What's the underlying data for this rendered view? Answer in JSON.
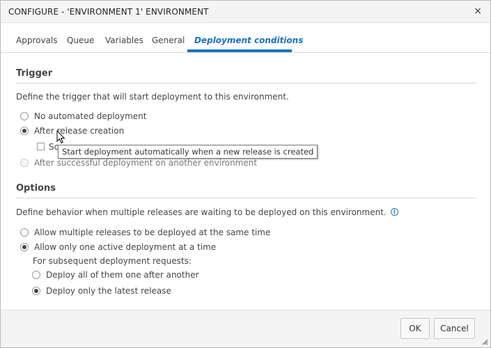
{
  "dialog": {
    "title": "CONFIGURE - 'ENVIRONMENT 1' ENVIRONMENT",
    "close_glyph": "×"
  },
  "tabs": [
    {
      "label": "Approvals",
      "active": false
    },
    {
      "label": "Queue",
      "active": false
    },
    {
      "label": "Variables",
      "active": false
    },
    {
      "label": "General",
      "active": false
    },
    {
      "label": "Deployment conditions",
      "active": true
    }
  ],
  "trigger": {
    "heading": "Trigger",
    "description": "Define the trigger that will start deployment to this environment.",
    "options": [
      {
        "label": "No automated deployment",
        "checked": false,
        "disabled": false
      },
      {
        "label": "After release creation",
        "checked": true,
        "disabled": false
      },
      {
        "label": "After successful deployment on another environment",
        "checked": false,
        "disabled": true
      }
    ],
    "schedule_checkbox_label_visible": "Sc",
    "tooltip": "Start deployment automatically when a new release is created"
  },
  "options_section": {
    "heading": "Options",
    "description": "Define behavior when multiple releases are waiting to be deployed on this environment.",
    "options": [
      {
        "label": "Allow multiple releases to be deployed at the same time",
        "checked": false
      },
      {
        "label": "Allow only one active deployment at a time",
        "checked": true
      }
    ],
    "subsequent_label": "For subsequent deployment requests:",
    "sub_options": [
      {
        "label": "Deploy all of them one after another",
        "checked": false
      },
      {
        "label": "Deploy only the latest release",
        "checked": true
      }
    ]
  },
  "footer": {
    "ok_label": "OK",
    "cancel_label": "Cancel"
  },
  "colors": {
    "accent": "#1f72c4"
  },
  "icons": {
    "close": "close-icon",
    "info": "info-icon",
    "cursor": "mouse-pointer-icon",
    "resize": "resize-grip-icon"
  }
}
